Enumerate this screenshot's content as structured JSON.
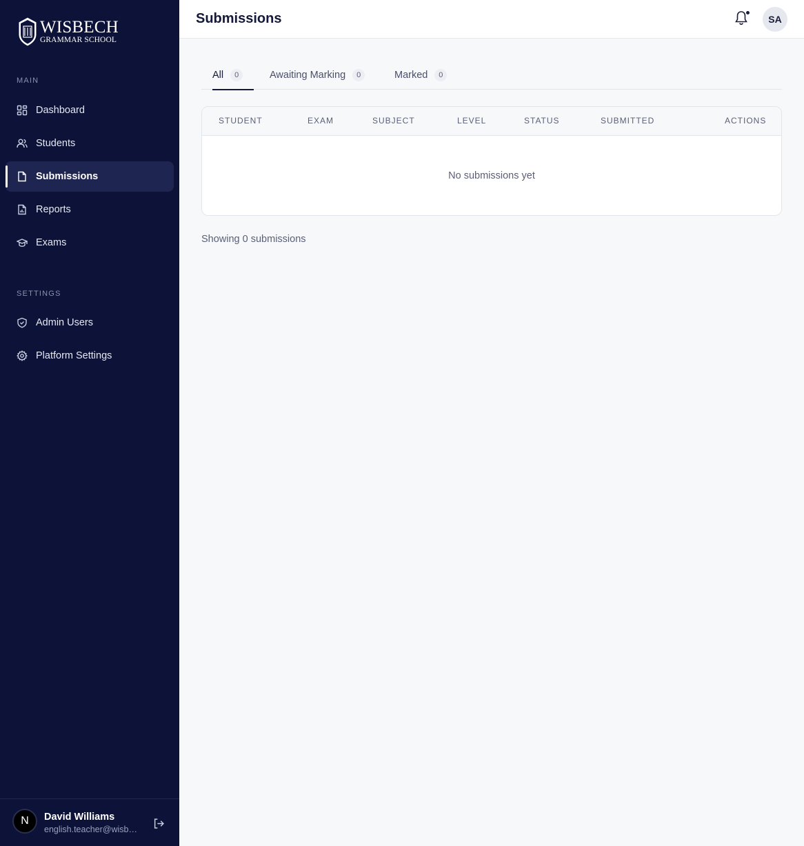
{
  "brand": {
    "name_top": "WISBECH",
    "name_bottom": "GRAMMAR SCHOOL"
  },
  "sidebar": {
    "main_label": "MAIN",
    "main_items": [
      {
        "label": "Dashboard",
        "icon": "grid-icon"
      },
      {
        "label": "Students",
        "icon": "users-icon"
      },
      {
        "label": "Submissions",
        "icon": "document-icon",
        "active": true
      },
      {
        "label": "Reports",
        "icon": "report-icon"
      },
      {
        "label": "Exams",
        "icon": "graduation-cap-icon"
      }
    ],
    "settings_label": "SETTINGS",
    "settings_items": [
      {
        "label": "Admin Users",
        "icon": "shield-check-icon"
      },
      {
        "label": "Platform Settings",
        "icon": "gear-icon"
      }
    ]
  },
  "user": {
    "initial": "N",
    "name": "David Williams",
    "email": "english.teacher@wisbech.org.uk"
  },
  "header": {
    "title": "Submissions",
    "avatar_initials": "SA"
  },
  "tabs": [
    {
      "label": "All",
      "count": "0",
      "active": true
    },
    {
      "label": "Awaiting Marking",
      "count": "0"
    },
    {
      "label": "Marked",
      "count": "0"
    }
  ],
  "table": {
    "columns": [
      "STUDENT",
      "EXAM",
      "SUBJECT",
      "LEVEL",
      "STATUS",
      "SUBMITTED",
      "ACTIONS"
    ],
    "empty_message": "No submissions yet"
  },
  "footer": {
    "showing": "Showing 0 submissions"
  },
  "colors": {
    "sidebar_bg": "#0c1238",
    "active_item_bg": "#1e2550",
    "page_bg": "#f7f8fa"
  }
}
